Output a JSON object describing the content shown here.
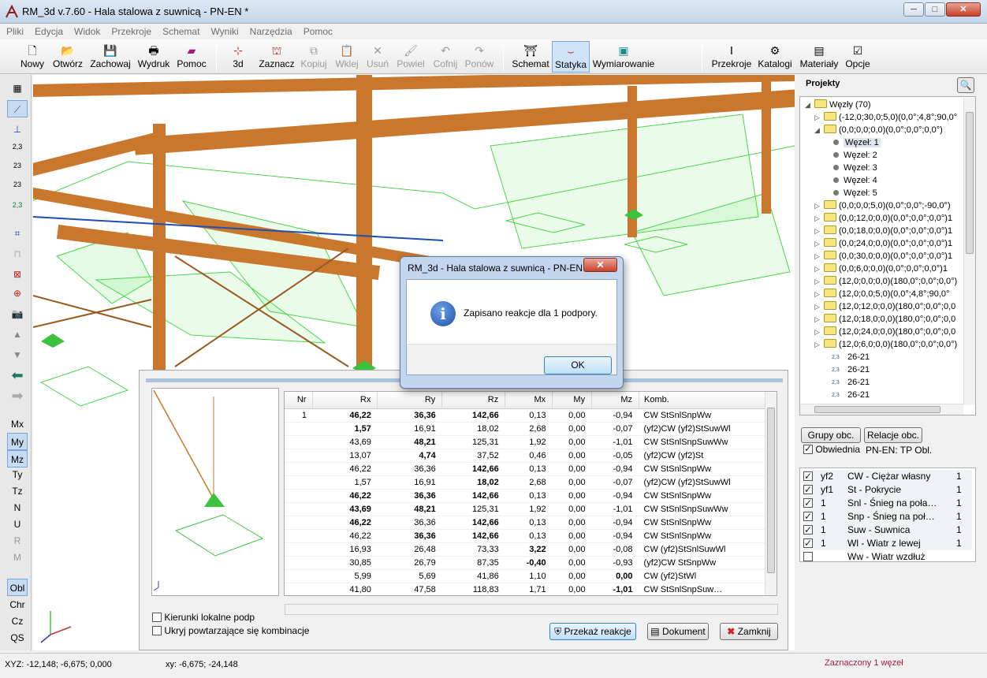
{
  "window": {
    "title": "RM_3d v.7.60 - Hala stalowa z suwnicą - PN-EN *",
    "minimize": "─",
    "maximize": "□",
    "close": "✕"
  },
  "menu": [
    "Pliki",
    "Edycja",
    "Widok",
    "Przekroje",
    "Schemat",
    "Wyniki",
    "Narzędzia",
    "Pomoc"
  ],
  "toolbar": {
    "nowy": "Nowy",
    "otworz": "Otwórz",
    "zachowaj": "Zachowaj",
    "wydruk": "Wydruk",
    "pomoc": "Pomoc",
    "v3d": "3d",
    "zaznacz": "Zaznacz",
    "kopiuj": "Kopiuj",
    "wklej": "Wklej",
    "usun": "Usuń",
    "powiel": "Powiel",
    "cofnij": "Cofnij",
    "ponow": "Ponów",
    "schemat": "Schemat",
    "statyka": "Statyka",
    "wymiarowanie": "Wymiarowanie",
    "przekroje": "Przekroje",
    "katalogi": "Katalogi",
    "materialy": "Materiały",
    "opcje": "Opcje"
  },
  "lefttools": [
    "Mx",
    "My",
    "Mz",
    "Ty",
    "Tz",
    "N",
    "U",
    "R",
    "M",
    "Obl",
    "Chr",
    "Cz",
    "QS"
  ],
  "projects": {
    "header": "Projekty",
    "tree": [
      {
        "level": 0,
        "exp": "◢",
        "folder": true,
        "label": "Węzły (70)"
      },
      {
        "level": 1,
        "exp": "▷",
        "folder": true,
        "label": "(-12,0;30,0;5,0)(0,0°;4,8°;90,0°"
      },
      {
        "level": 1,
        "exp": "◢",
        "folder": true,
        "label": "(0,0;0,0;0,0)(0,0°;0,0°;0,0°)"
      },
      {
        "level": 2,
        "node": true,
        "label": "Węzeł: 1"
      },
      {
        "level": 2,
        "node": true,
        "label": "Węzeł: 2"
      },
      {
        "level": 2,
        "node": true,
        "label": "Węzeł: 3"
      },
      {
        "level": 2,
        "node": true,
        "label": "Węzeł: 4"
      },
      {
        "level": 2,
        "node": true,
        "label": "Węzeł: 5"
      },
      {
        "level": 1,
        "exp": "▷",
        "folder": true,
        "label": "(0,0;0,0;5,0)(0,0°;0,0°;-90,0°)"
      },
      {
        "level": 1,
        "exp": "▷",
        "folder": true,
        "label": "(0,0;12,0;0,0)(0,0°;0,0°;0,0°)1"
      },
      {
        "level": 1,
        "exp": "▷",
        "folder": true,
        "label": "(0,0;18,0;0,0)(0,0°;0,0°;0,0°)1"
      },
      {
        "level": 1,
        "exp": "▷",
        "folder": true,
        "label": "(0,0;24,0;0,0)(0,0°;0,0°;0,0°)1"
      },
      {
        "level": 1,
        "exp": "▷",
        "folder": true,
        "label": "(0,0;30,0;0,0)(0,0°;0,0°;0,0°)1"
      },
      {
        "level": 1,
        "exp": "▷",
        "folder": true,
        "label": "(0,0;6,0;0,0)(0,0°;0,0°;0,0°)1"
      },
      {
        "level": 1,
        "exp": "▷",
        "folder": true,
        "label": "(12,0;0,0;0,0)(180,0°;0,0°;0,0°)"
      },
      {
        "level": 1,
        "exp": "▷",
        "folder": true,
        "label": "(12,0;0,0;5,0)(0,0°;4,8°;90,0°"
      },
      {
        "level": 1,
        "exp": "▷",
        "folder": true,
        "label": "(12,0;12,0;0,0)(180,0°;0,0°;0,0"
      },
      {
        "level": 1,
        "exp": "▷",
        "folder": true,
        "label": "(12,0;18,0;0,0)(180,0°;0,0°;0,0"
      },
      {
        "level": 1,
        "exp": "▷",
        "folder": true,
        "label": "(12,0;24,0;0,0)(180,0°;0,0°;0,0"
      },
      {
        "level": 1,
        "exp": "▷",
        "folder": true,
        "label": "(12,0;6,0;0,0)(180,0°;0,0°;0,0°)"
      },
      {
        "level": 1,
        "bar": true,
        "label": "26-21"
      },
      {
        "level": 1,
        "bar": true,
        "label": "26-21"
      },
      {
        "level": 1,
        "bar": true,
        "label": "26-21"
      },
      {
        "level": 1,
        "bar": true,
        "label": "26-21"
      }
    ]
  },
  "loads": {
    "grupy": "Grupy obc.",
    "relacje": "Relacje obc.",
    "obwiednia": "Obwiednia",
    "norm": "PN-EN:  TP Obl.",
    "rows": [
      {
        "on": true,
        "id": "yf2",
        "name": "CW - Ciężar własny",
        "n": "1"
      },
      {
        "on": true,
        "id": "yf1",
        "name": "St - Pokrycie",
        "n": "1"
      },
      {
        "on": true,
        "id": "1",
        "name": "Snl - Śnieg na poła…",
        "n": "1"
      },
      {
        "on": true,
        "id": "1",
        "name": "Snp - Śnieg na poł…",
        "n": "1"
      },
      {
        "on": true,
        "id": "1",
        "name": "Suw - Suwnica",
        "n": "1"
      },
      {
        "on": true,
        "id": "1",
        "name": "Wl - Wiatr z lewej",
        "n": "1"
      },
      {
        "on": false,
        "id": "",
        "name": "Ww - Wiatr wzdłuż",
        "n": ""
      }
    ]
  },
  "results": {
    "headers": [
      "Nr",
      "Rx",
      "Ry",
      "Rz",
      "Mx",
      "My",
      "Mz",
      "Komb."
    ],
    "rows": [
      [
        "1",
        "46,22",
        "36,36",
        "142,66",
        "0,13",
        "0,00",
        "-0,94",
        "CW StSnlSnpWw"
      ],
      [
        "",
        "1,57",
        "16,91",
        "18,02",
        "2,68",
        "0,00",
        "-0,07",
        "(yf2)CW (yf2)StSuwWl"
      ],
      [
        "",
        "43,69",
        "48,21",
        "125,31",
        "1,92",
        "0,00",
        "-1,01",
        "CW StSnlSnpSuwWw"
      ],
      [
        "",
        "13,07",
        "4,74",
        "37,52",
        "0,46",
        "0,00",
        "-0,05",
        "(yf2)CW (yf2)St"
      ],
      [
        "",
        "46,22",
        "36,36",
        "142,66",
        "0,13",
        "0,00",
        "-0,94",
        "CW StSnlSnpWw"
      ],
      [
        "",
        "1,57",
        "16,91",
        "18,02",
        "2,68",
        "0,00",
        "-0,07",
        "(yf2)CW (yf2)StSuwWl"
      ],
      [
        "",
        "46,22",
        "36,36",
        "142,66",
        "0,13",
        "0,00",
        "-0,94",
        "CW StSnlSnpWw"
      ],
      [
        "",
        "43,69",
        "48,21",
        "125,31",
        "1,92",
        "0,00",
        "-1,01",
        "CW StSnlSnpSuwWw"
      ],
      [
        "",
        "46,22",
        "36,36",
        "142,66",
        "0,13",
        "0,00",
        "-0,94",
        "CW StSnlSnpWw"
      ],
      [
        "",
        "46,22",
        "36,36",
        "142,66",
        "0,13",
        "0,00",
        "-0,94",
        "CW StSnlSnpWw"
      ],
      [
        "",
        "16,93",
        "26,48",
        "73,33",
        "3,22",
        "0,00",
        "-0,08",
        "CW (yf2)StSnlSuwWl"
      ],
      [
        "",
        "30,85",
        "26,79",
        "87,35",
        "-0,40",
        "0,00",
        "-0,93",
        "(yf2)CW StSnpWw"
      ],
      [
        "",
        "5,99",
        "5,69",
        "41,86",
        "1,10",
        "0,00",
        "0,00",
        "CW (yf2)StWl"
      ],
      [
        "",
        "41,80",
        "47,58",
        "118,83",
        "1,71",
        "0,00",
        "-1,01",
        "CW StSnlSnpSuw…"
      ]
    ],
    "bold": [
      [
        1,
        2,
        3
      ],
      [
        1
      ],
      [
        2
      ],
      [
        2
      ],
      [
        3
      ],
      [
        3
      ],
      [
        1,
        2,
        3
      ],
      [
        1,
        2
      ],
      [
        1,
        3
      ],
      [
        2,
        3
      ],
      [
        4
      ],
      [
        4
      ],
      [
        6
      ],
      [
        6
      ]
    ],
    "chk1": "Kierunki lokalne podp",
    "chk2": "Ukryj powtarzające się kombinacje",
    "przekaz": "Przekaż reakcje",
    "dokument": "Dokument",
    "zamknij": "Zamknij"
  },
  "dialog": {
    "title": "RM_3d - Hala stalowa z suwnicą - PN-EN",
    "message": "Zapisano reakcje dla 1 podpory.",
    "ok": "OK",
    "close": "✕"
  },
  "status": {
    "xyz": "XYZ: -12,148; -6,675; 0,000",
    "xy": "xy: -6,675; -24,148",
    "sel": "Zaznaczony 1 węzeł"
  },
  "tick_label": "2,3"
}
